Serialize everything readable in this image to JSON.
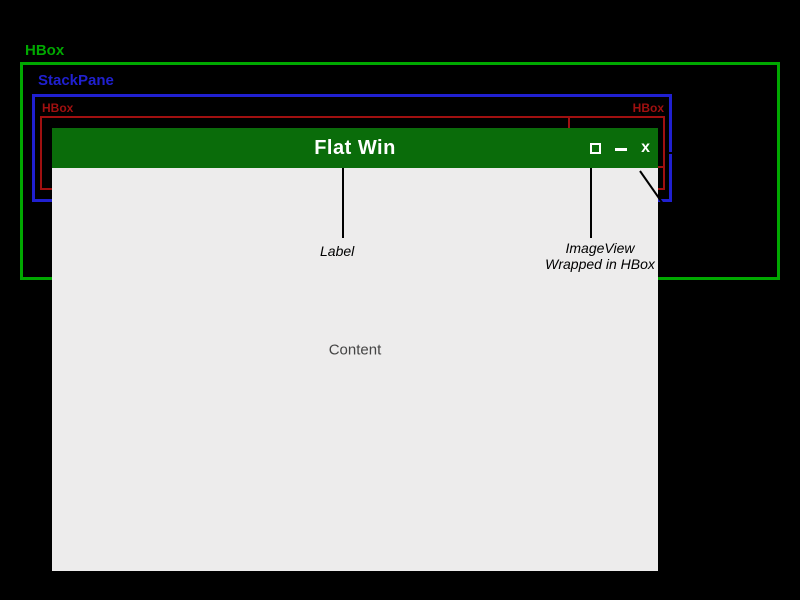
{
  "diagram": {
    "outer_hbox_label": "HBox",
    "stackpane_label": "StackPane",
    "inner_hbox1_label": "HBox",
    "inner_hbox2_label": "HBox",
    "callout_label": "Label",
    "callout_imageview_line1": "ImageView",
    "callout_imageview_line2": "Wrapped in HBox"
  },
  "window": {
    "title": "Flat Win",
    "content": "Content",
    "controls": {
      "maximize": "□",
      "minimize": "_",
      "close": "x"
    }
  },
  "colors": {
    "hbox_border": "#00a800",
    "stackpane_border": "#2020d0",
    "inner_hbox_border": "#a01010",
    "titlebar_bg": "#0a6c0a",
    "panel_bg": "#edecec"
  }
}
